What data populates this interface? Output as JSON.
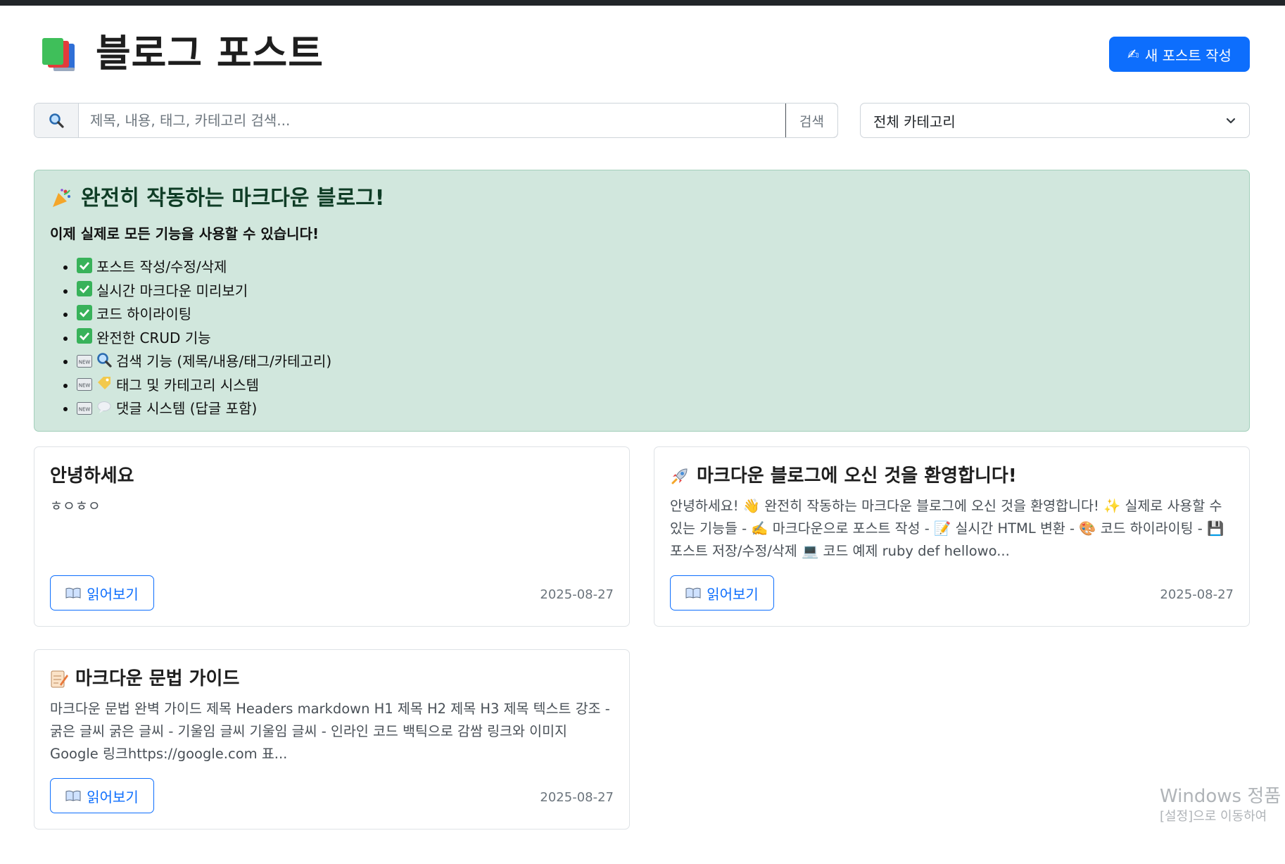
{
  "header": {
    "title": "블로그 포스트",
    "logo_icon": "books-icon",
    "new_post_label": "새 포스트 작성",
    "new_post_icon": "writing-hand-icon"
  },
  "search": {
    "placeholder": "제목, 내용, 태그, 카테고리 검색...",
    "value": "",
    "button_label": "검색",
    "category_selected": "전체 카테고리"
  },
  "alert": {
    "title": "완전히 작동하는 마크다운 블로그!",
    "subtitle": "이제 실제로 모든 기능을 사용할 수 있습니다!",
    "items": [
      {
        "icon": "check-mark-icon",
        "text": "포스트 작성/수정/삭제"
      },
      {
        "icon": "check-mark-icon",
        "text": "실시간 마크다운 미리보기"
      },
      {
        "icon": "check-mark-icon",
        "text": "코드 하이라이팅"
      },
      {
        "icon": "check-mark-icon",
        "text": "완전한 CRUD 기능"
      },
      {
        "icon": "new-search-icon",
        "text": "검색 기능 (제목/내용/태그/카테고리)"
      },
      {
        "icon": "new-tag-icon",
        "text": "태그 및 카테고리 시스템"
      },
      {
        "icon": "new-speech-icon",
        "text": "댓글 시스템 (답글 포함)"
      }
    ]
  },
  "posts": [
    {
      "title": "안녕하세요",
      "icon": "",
      "excerpt": "ㅎㅇㅎㅇ",
      "read_label": "읽어보기",
      "date": "2025-08-27"
    },
    {
      "title": "마크다운 블로그에 오신 것을 환영합니다!",
      "icon": "rocket-icon",
      "excerpt": "안녕하세요! 👋 완전히 작동하는 마크다운 블로그에 오신 것을 환영합니다! ✨ 실제로 사용할 수 있는 기능들 - ✍️ 마크다운으로 포스트 작성 - 📝 실시간 HTML 변환 - 🎨 코드 하이라이팅 - 💾 포스트 저장/수정/삭제 💻 코드 예제 ruby def hellowo...",
      "read_label": "읽어보기",
      "date": "2025-08-27"
    },
    {
      "title": "마크다운 문법 가이드",
      "icon": "memo-icon",
      "excerpt": "마크다운 문법 완벽 가이드 제목 Headers markdown H1 제목 H2 제목 H3 제목 텍스트 강조 - 굵은 글씨 굵은 글씨 - 기울임 글씨 기울임 글씨 - 인라인 코드 백틱으로 감쌈 링크와 이미지 Google 링크https://google.com 표...",
      "read_label": "읽어보기",
      "date": "2025-08-27"
    }
  ],
  "watermark": {
    "line1": "Windows 정품",
    "line2": "[설정]으로 이동하여"
  },
  "colors": {
    "primary": "#0d6efd",
    "alert_bg": "#d1e7dd",
    "alert_border": "#a3cfbb",
    "topbar": "#212529"
  }
}
